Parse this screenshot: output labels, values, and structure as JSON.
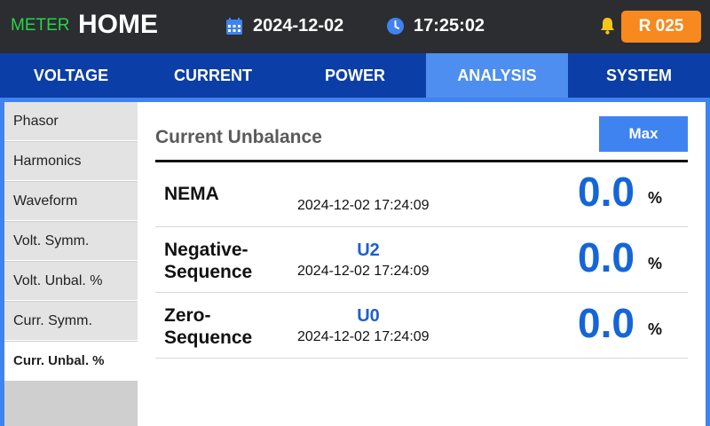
{
  "header": {
    "brand_small": "METER",
    "brand_big": "HOME",
    "date": "2024-12-02",
    "time": "17:25:02",
    "record_label": "R 025",
    "accent_color": "#f7891f",
    "brand_color": "#27d34a"
  },
  "tabs": [
    {
      "label": "VOLTAGE",
      "active": false
    },
    {
      "label": "CURRENT",
      "active": false
    },
    {
      "label": "POWER",
      "active": false
    },
    {
      "label": "ANALYSIS",
      "active": true
    },
    {
      "label": "SYSTEM",
      "active": false
    }
  ],
  "sidebar": {
    "items": [
      {
        "label": "Phasor"
      },
      {
        "label": "Harmonics"
      },
      {
        "label": "Waveform"
      },
      {
        "label": "Volt. Symm."
      },
      {
        "label": "Volt. Unbal. %"
      },
      {
        "label": "Curr. Symm."
      },
      {
        "label": "Curr. Unbal. %",
        "active": true
      }
    ]
  },
  "panel": {
    "title": "Current Unbalance",
    "max_label": "Max",
    "rows": [
      {
        "name_line1": "NEMA",
        "name_line2": "",
        "code": "",
        "timestamp": "2024-12-02 17:24:09",
        "value": "0.0",
        "unit": "%"
      },
      {
        "name_line1": "Negative-",
        "name_line2": "Sequence",
        "code": "U2",
        "timestamp": "2024-12-02 17:24:09",
        "value": "0.0",
        "unit": "%"
      },
      {
        "name_line1": "Zero-",
        "name_line2": "Sequence",
        "code": "U0",
        "timestamp": "2024-12-02 17:24:09",
        "value": "0.0",
        "unit": "%"
      }
    ]
  },
  "icons": {
    "date": "calendar-icon",
    "time": "clock-icon",
    "alarm": "bell-icon"
  }
}
